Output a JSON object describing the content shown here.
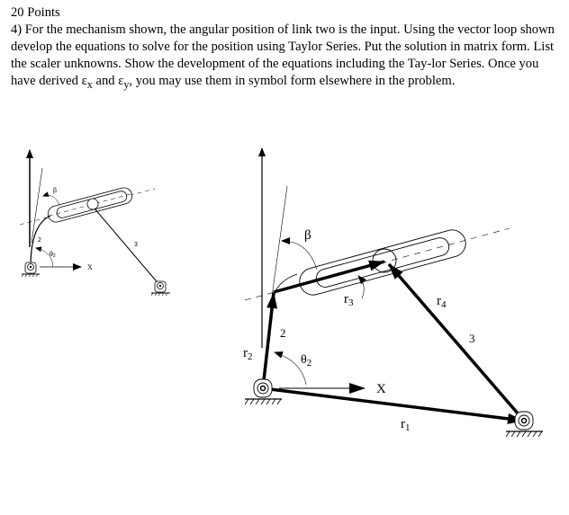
{
  "header": {
    "points": "20 Points"
  },
  "problem": {
    "text_before_eps": "4) For the mechanism shown, the angular position of link two is the input. Using the vector loop shown develop the equations to solve for the position using Taylor Series. Put the solution in matrix form. List the scaler unknowns. Show the development of the equations including the Tay-lor Series. Once you have derived ",
    "eps_x": "ε",
    "eps_x_sub": "x",
    "and": " and ",
    "eps_y": "ε",
    "eps_y_sub": "y",
    "text_after_eps": ", you may use them in symbol form elsewhere in the problem."
  },
  "small_diagram": {
    "beta": "β",
    "link2": "2",
    "theta2": "θ",
    "theta2_sub": "2",
    "link3": "3",
    "x_axis": "X"
  },
  "large_diagram": {
    "beta": "β",
    "r3": "r",
    "r3_sub": "3",
    "r4": "r",
    "r4_sub": "4",
    "link3": "3",
    "link2": "2",
    "r2": "r",
    "r2_sub": "2",
    "theta2": "θ",
    "theta2_sub": "2",
    "x_axis": "X",
    "r1": "r",
    "r1_sub": "1"
  }
}
